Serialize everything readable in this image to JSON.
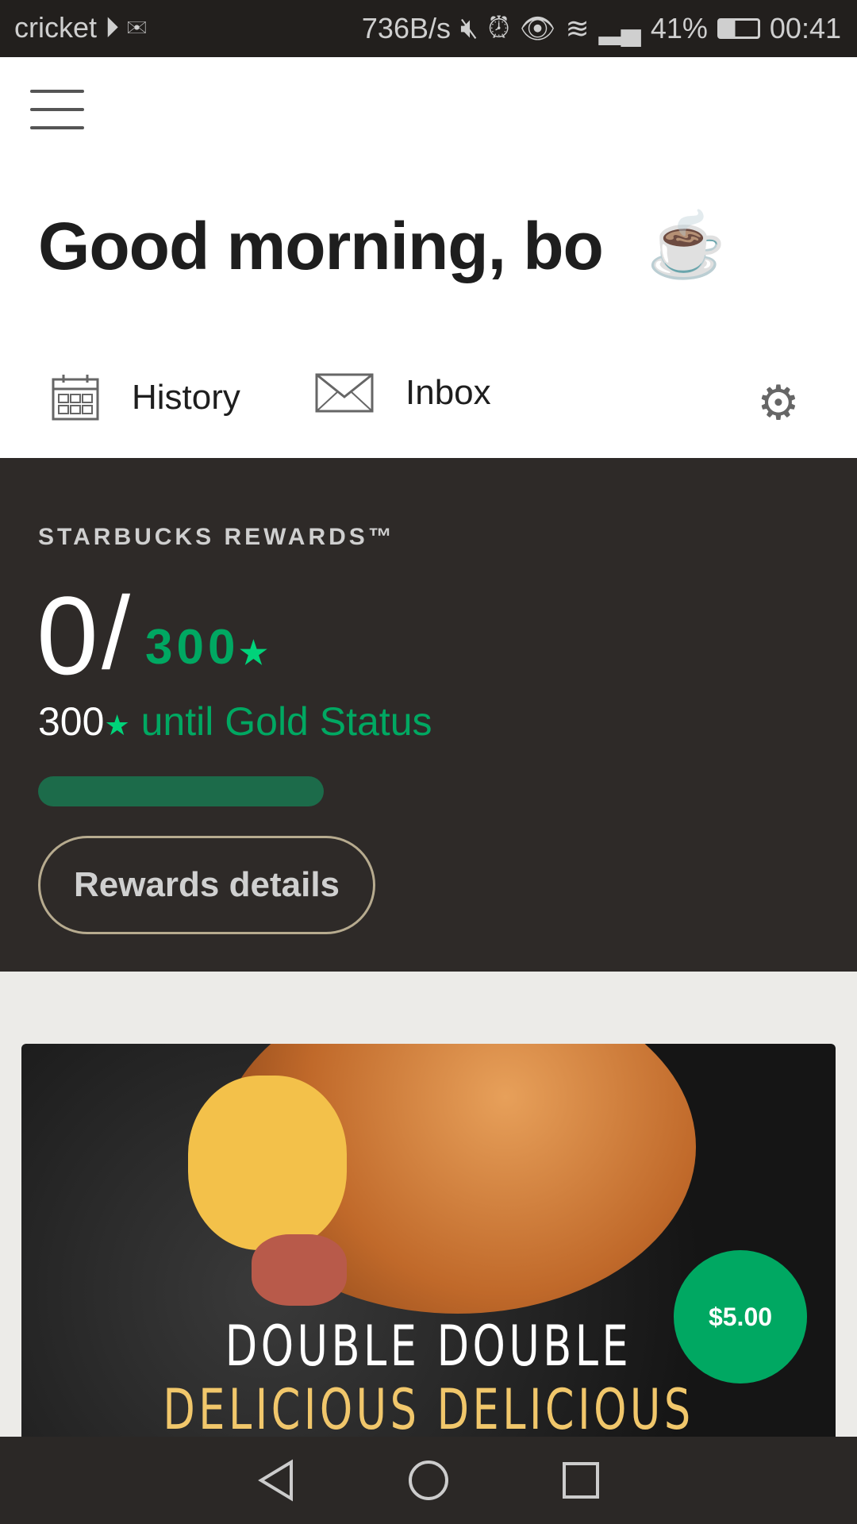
{
  "status_bar": {
    "carrier": "cricket",
    "net_speed": "736B/s",
    "battery": "41%",
    "time": "00:41",
    "icons": [
      "play-store-icon",
      "gmail-icon",
      "mute-icon",
      "alarm-icon",
      "eye-icon",
      "wifi-icon",
      "signal-icon",
      "battery-icon"
    ]
  },
  "header": {
    "greeting": "Good morning, bo",
    "emoji": "☕",
    "history_label": "History",
    "inbox_label": "Inbox"
  },
  "rewards": {
    "label": "STARBUCKS REWARDS™",
    "current": "0",
    "slash": "/",
    "goal": "300",
    "star": "★",
    "until_count": "300",
    "until_text": "until Gold Status",
    "progress": 0,
    "button": "Rewards details"
  },
  "promo": {
    "line1": "DOUBLE DOUBLE",
    "line2": "DELICIOUS DELICIOUS",
    "price": "$5.00"
  },
  "colors": {
    "green": "#00a862",
    "dark": "#2e2a28",
    "track": "#1c6b4a"
  }
}
